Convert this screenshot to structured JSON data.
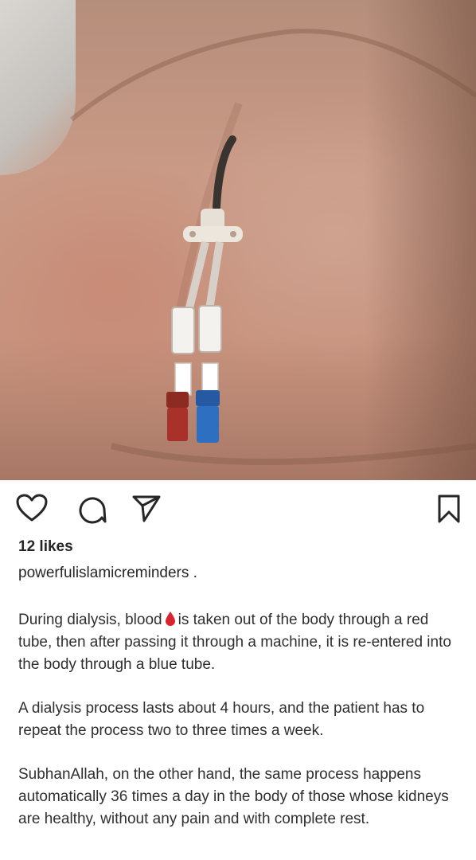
{
  "post": {
    "image_alt": "Dialysis catheter in upper chest",
    "likes_text": "12 likes",
    "username": "powerfulislamicreminders .",
    "caption": {
      "p1_before": "During dialysis, blood",
      "p1_after": "is taken out of the body through a red tube, then after passing it through a machine, it is re-entered into the body through a blue tube.",
      "p2": "A dialysis process lasts about 4 hours, and the patient has to repeat the process two to three times a week.",
      "p3": "SubhanAllah, on the other hand, the same process happens automatically 36 times a day in the body of those whose kidneys are healthy, without any pain and with complete rest."
    }
  },
  "icons": {
    "like": "heart-icon",
    "comment": "comment-icon",
    "share": "paper-plane-icon",
    "save": "bookmark-icon",
    "inline": "blood-drop-icon"
  },
  "colors": {
    "text": "#262626",
    "blood_drop": "#d9232e",
    "red_cap": "#a8322a",
    "blue_cap": "#2f6fc1"
  }
}
